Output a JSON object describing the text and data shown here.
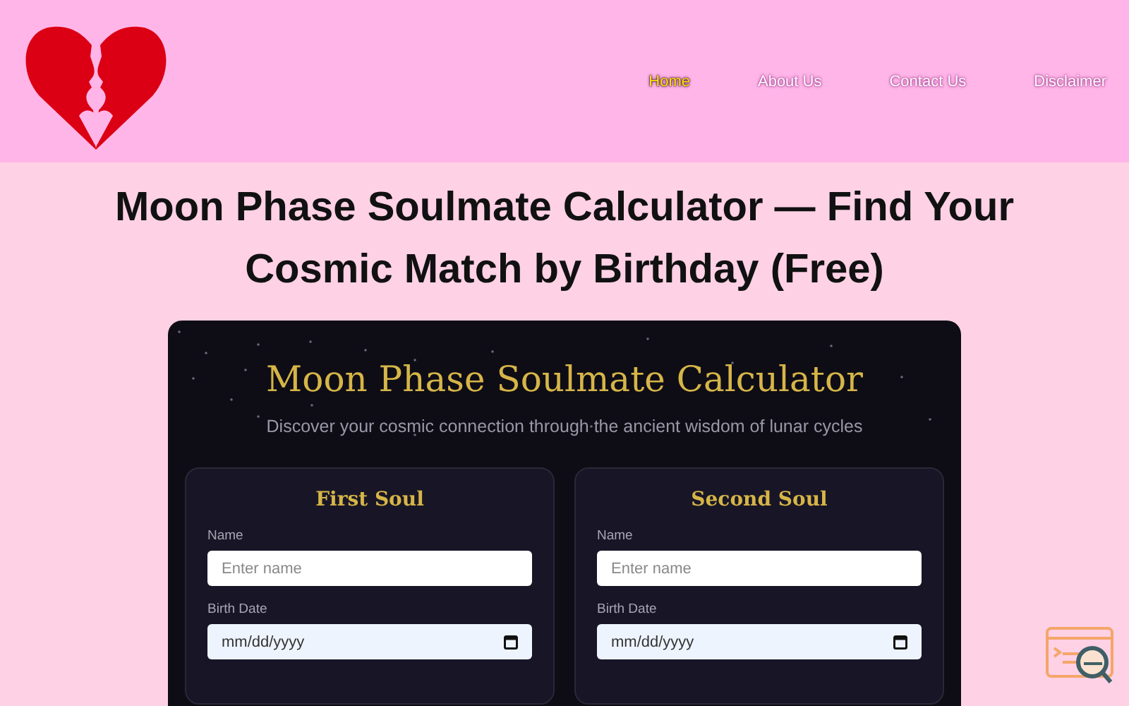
{
  "nav": [
    {
      "label": "Home",
      "selected": true
    },
    {
      "label": "About Us",
      "selected": false
    },
    {
      "label": "Contact Us",
      "selected": false
    },
    {
      "label": "Disclaimer",
      "selected": false
    }
  ],
  "page_title": "Moon Phase Soulmate Calculator — Find Your Cosmic Match by Birthday (Free)",
  "calculator": {
    "title": "Moon Phase Soulmate Calculator",
    "subtitle": "Discover your cosmic connection through the ancient wisdom of lunar cycles",
    "panels": [
      {
        "title": "First Soul",
        "fields": [
          {
            "kind": "text",
            "label": "Name",
            "placeholder": "Enter name"
          },
          {
            "kind": "date",
            "label": "Birth Date",
            "value": "mm/dd/yyyy"
          }
        ]
      },
      {
        "title": "Second Soul",
        "fields": [
          {
            "kind": "text",
            "label": "Name",
            "placeholder": "Enter name"
          },
          {
            "kind": "date",
            "label": "Birth Date",
            "value": "mm/dd/yyyy"
          }
        ]
      }
    ]
  }
}
